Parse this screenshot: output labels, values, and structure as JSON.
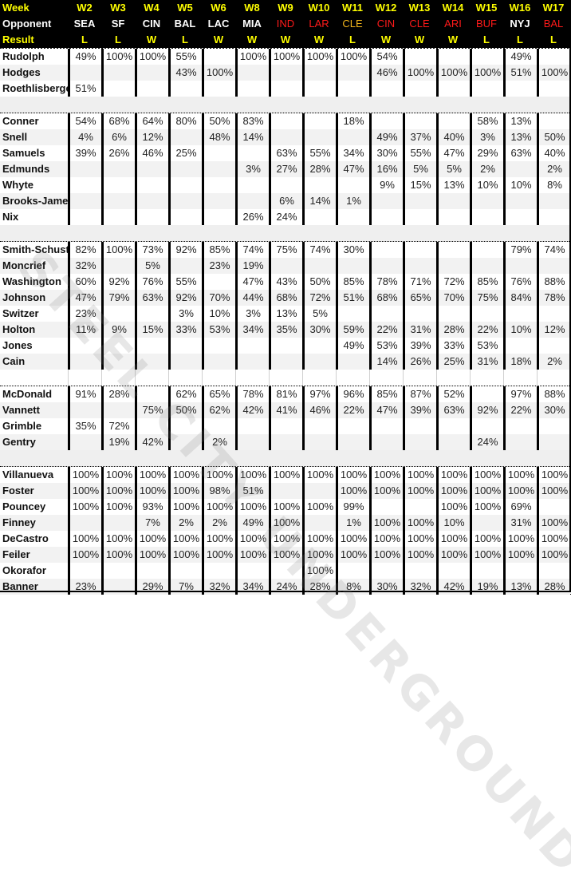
{
  "header": {
    "week_label": "Week",
    "opponent_label": "Opponent",
    "result_label": "Result",
    "weeks": [
      "W2",
      "W3",
      "W4",
      "W5",
      "W6",
      "W8",
      "W9",
      "W10",
      "W11",
      "W12",
      "W13",
      "W14",
      "W15",
      "W16",
      "W17"
    ],
    "opponents": [
      {
        "name": "SEA",
        "style": "white"
      },
      {
        "name": "SF",
        "style": "white"
      },
      {
        "name": "CIN",
        "style": "white"
      },
      {
        "name": "BAL",
        "style": "white"
      },
      {
        "name": "LAC",
        "style": "white"
      },
      {
        "name": "MIA",
        "style": "white"
      },
      {
        "name": "IND",
        "style": "away-red"
      },
      {
        "name": "LAR",
        "style": "away-red"
      },
      {
        "name": "CLE",
        "style": "gold"
      },
      {
        "name": "CIN",
        "style": "away-red"
      },
      {
        "name": "CLE",
        "style": "away-red"
      },
      {
        "name": "ARI",
        "style": "away-red"
      },
      {
        "name": "BUF",
        "style": "away-red"
      },
      {
        "name": "NYJ",
        "style": "white"
      },
      {
        "name": "BAL",
        "style": "away-red"
      }
    ],
    "results": [
      "L",
      "L",
      "W",
      "L",
      "W",
      "W",
      "W",
      "W",
      "L",
      "W",
      "W",
      "W",
      "L",
      "L",
      "L"
    ]
  },
  "colors": {
    "header_bg": "#000000",
    "header_accent": "#ffff00",
    "away_red": "#ff1a1a",
    "gold": "#f2b51c",
    "row_alt": "#f2f2f2"
  },
  "groups": [
    {
      "rows": [
        {
          "name": "Rudolph",
          "values": [
            "49%",
            "100%",
            "100%",
            "55%",
            "",
            "100%",
            "100%",
            "100%",
            "100%",
            "54%",
            "",
            "",
            "",
            "49%",
            ""
          ]
        },
        {
          "name": "Hodges",
          "values": [
            "",
            "",
            "",
            "43%",
            "100%",
            "",
            "",
            "",
            "",
            "46%",
            "100%",
            "100%",
            "100%",
            "51%",
            "100%"
          ]
        },
        {
          "name": "Roethlisberger",
          "values": [
            "51%",
            "",
            "",
            "",
            "",
            "",
            "",
            "",
            "",
            "",
            "",
            "",
            "",
            "",
            ""
          ]
        }
      ]
    },
    {
      "rows": [
        {
          "name": "Conner",
          "values": [
            "54%",
            "68%",
            "64%",
            "80%",
            "50%",
            "83%",
            "",
            "",
            "18%",
            "",
            "",
            "",
            "58%",
            "13%",
            ""
          ]
        },
        {
          "name": "Snell",
          "values": [
            "4%",
            "6%",
            "12%",
            "",
            "48%",
            "14%",
            "",
            "",
            "",
            "49%",
            "37%",
            "40%",
            "3%",
            "13%",
            "50%"
          ]
        },
        {
          "name": "Samuels",
          "values": [
            "39%",
            "26%",
            "46%",
            "25%",
            "",
            "",
            "63%",
            "55%",
            "34%",
            "30%",
            "55%",
            "47%",
            "29%",
            "63%",
            "40%"
          ]
        },
        {
          "name": "Edmunds",
          "values": [
            "",
            "",
            "",
            "",
            "",
            "3%",
            "27%",
            "28%",
            "47%",
            "16%",
            "5%",
            "5%",
            "2%",
            "",
            "2%"
          ]
        },
        {
          "name": "Whyte",
          "values": [
            "",
            "",
            "",
            "",
            "",
            "",
            "",
            "",
            "",
            "9%",
            "15%",
            "13%",
            "10%",
            "10%",
            "8%"
          ]
        },
        {
          "name": "Brooks-James",
          "values": [
            "",
            "",
            "",
            "",
            "",
            "",
            "6%",
            "14%",
            "1%",
            "",
            "",
            "",
            "",
            "",
            ""
          ]
        },
        {
          "name": "Nix",
          "values": [
            "",
            "",
            "",
            "",
            "",
            "26%",
            "24%",
            "",
            "",
            "",
            "",
            "",
            "",
            "",
            ""
          ]
        }
      ]
    },
    {
      "rows": [
        {
          "name": "Smith-Schuster",
          "values": [
            "82%",
            "100%",
            "73%",
            "92%",
            "85%",
            "74%",
            "75%",
            "74%",
            "30%",
            "",
            "",
            "",
            "",
            "79%",
            "74%"
          ]
        },
        {
          "name": "Moncrief",
          "values": [
            "32%",
            "",
            "5%",
            "",
            "23%",
            "19%",
            "",
            "",
            "",
            "",
            "",
            "",
            "",
            "",
            ""
          ]
        },
        {
          "name": "Washington",
          "values": [
            "60%",
            "92%",
            "76%",
            "55%",
            "",
            "47%",
            "43%",
            "50%",
            "85%",
            "78%",
            "71%",
            "72%",
            "85%",
            "76%",
            "88%"
          ]
        },
        {
          "name": "Johnson",
          "values": [
            "47%",
            "79%",
            "63%",
            "92%",
            "70%",
            "44%",
            "68%",
            "72%",
            "51%",
            "68%",
            "65%",
            "70%",
            "75%",
            "84%",
            "78%"
          ]
        },
        {
          "name": "Switzer",
          "values": [
            "23%",
            "",
            "",
            "3%",
            "10%",
            "3%",
            "13%",
            "5%",
            "",
            "",
            "",
            "",
            "",
            "",
            ""
          ]
        },
        {
          "name": "Holton",
          "values": [
            "11%",
            "9%",
            "15%",
            "33%",
            "53%",
            "34%",
            "35%",
            "30%",
            "59%",
            "22%",
            "31%",
            "28%",
            "22%",
            "10%",
            "12%"
          ]
        },
        {
          "name": "Jones",
          "values": [
            "",
            "",
            "",
            "",
            "",
            "",
            "",
            "",
            "49%",
            "53%",
            "39%",
            "33%",
            "53%",
            "",
            ""
          ]
        },
        {
          "name": "Cain",
          "values": [
            "",
            "",
            "",
            "",
            "",
            "",
            "",
            "",
            "",
            "14%",
            "26%",
            "25%",
            "31%",
            "18%",
            "2%"
          ]
        }
      ]
    },
    {
      "rows": [
        {
          "name": "McDonald",
          "values": [
            "91%",
            "28%",
            "",
            "62%",
            "65%",
            "78%",
            "81%",
            "97%",
            "96%",
            "85%",
            "87%",
            "52%",
            "",
            "97%",
            "88%"
          ]
        },
        {
          "name": "Vannett",
          "values": [
            "",
            "",
            "75%",
            "50%",
            "62%",
            "42%",
            "41%",
            "46%",
            "22%",
            "47%",
            "39%",
            "63%",
            "92%",
            "22%",
            "30%"
          ]
        },
        {
          "name": "Grimble",
          "values": [
            "35%",
            "72%",
            "",
            "",
            "",
            "",
            "",
            "",
            "",
            "",
            "",
            "",
            "",
            "",
            ""
          ]
        },
        {
          "name": "Gentry",
          "values": [
            "",
            "19%",
            "42%",
            "",
            "2%",
            "",
            "",
            "",
            "",
            "",
            "",
            "",
            "24%",
            "",
            ""
          ]
        }
      ]
    },
    {
      "rows": [
        {
          "name": "Villanueva",
          "values": [
            "100%",
            "100%",
            "100%",
            "100%",
            "100%",
            "100%",
            "100%",
            "100%",
            "100%",
            "100%",
            "100%",
            "100%",
            "100%",
            "100%",
            "100%"
          ]
        },
        {
          "name": "Foster",
          "values": [
            "100%",
            "100%",
            "100%",
            "100%",
            "98%",
            "51%",
            "",
            "",
            "100%",
            "100%",
            "100%",
            "100%",
            "100%",
            "100%",
            "100%"
          ]
        },
        {
          "name": "Pouncey",
          "values": [
            "100%",
            "100%",
            "93%",
            "100%",
            "100%",
            "100%",
            "100%",
            "100%",
            "99%",
            "",
            "",
            "100%",
            "100%",
            "69%",
            ""
          ]
        },
        {
          "name": "Finney",
          "values": [
            "",
            "",
            "7%",
            "2%",
            "2%",
            "49%",
            "100%",
            "",
            "1%",
            "100%",
            "100%",
            "10%",
            "",
            "31%",
            "100%"
          ]
        },
        {
          "name": "DeCastro",
          "values": [
            "100%",
            "100%",
            "100%",
            "100%",
            "100%",
            "100%",
            "100%",
            "100%",
            "100%",
            "100%",
            "100%",
            "100%",
            "100%",
            "100%",
            "100%"
          ]
        },
        {
          "name": "Feiler",
          "values": [
            "100%",
            "100%",
            "100%",
            "100%",
            "100%",
            "100%",
            "100%",
            "100%",
            "100%",
            "100%",
            "100%",
            "100%",
            "100%",
            "100%",
            "100%"
          ]
        },
        {
          "name": "Okorafor",
          "values": [
            "",
            "",
            "",
            "",
            "",
            "",
            "",
            "100%",
            "",
            "",
            "",
            "",
            "",
            "",
            ""
          ]
        },
        {
          "name": "Banner",
          "values": [
            "23%",
            "",
            "29%",
            "7%",
            "32%",
            "34%",
            "24%",
            "28%",
            "8%",
            "30%",
            "32%",
            "42%",
            "19%",
            "13%",
            "28%"
          ]
        }
      ]
    }
  ],
  "watermark": "STEEL CITY UNDERGROUND"
}
